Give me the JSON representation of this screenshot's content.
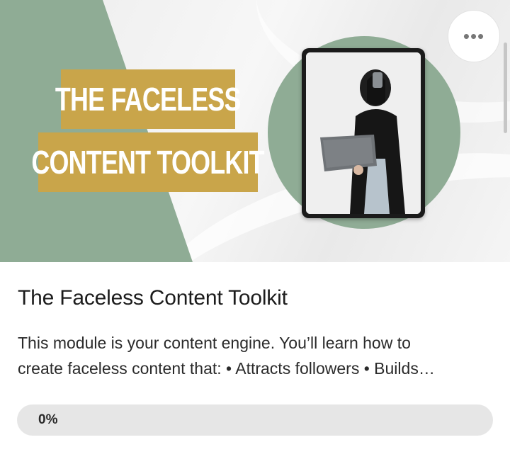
{
  "banner": {
    "title_line1": "THE FACELESS",
    "title_line2": "CONTENT TOOLKIT",
    "more_icon": "more-horizontal-icon",
    "more_label": "•••"
  },
  "module": {
    "title": "The Faceless Content Toolkit",
    "description_line1": "This module is your content engine. You’ll learn how to",
    "description_line2": "create faceless content that: • Attracts followers • Builds…"
  },
  "progress": {
    "value": 0,
    "label": "0%"
  },
  "colors": {
    "sage_green": "#8fac95",
    "gold": "#c9a54a",
    "progress_track": "#e6e6e6"
  }
}
